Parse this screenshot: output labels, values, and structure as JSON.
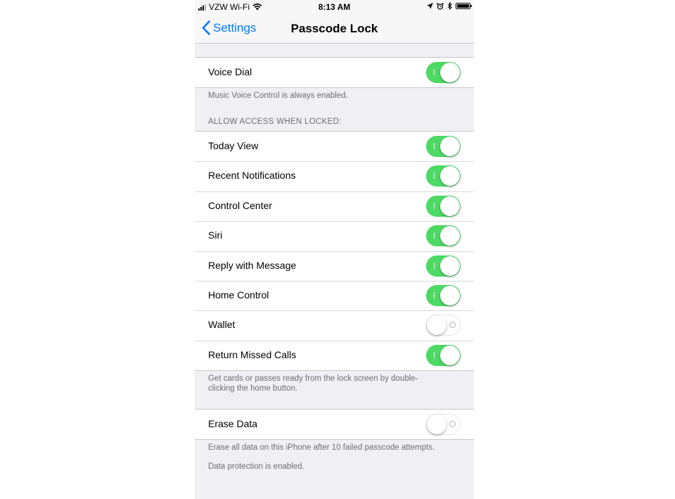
{
  "status_bar": {
    "carrier": "VZW Wi-Fi",
    "time": "8:13 AM"
  },
  "nav": {
    "back_label": "Settings",
    "title": "Passcode Lock"
  },
  "voice_dial": {
    "label": "Voice Dial",
    "on": true,
    "footer": "Music Voice Control is always enabled."
  },
  "locked_access": {
    "header": "ALLOW ACCESS WHEN LOCKED:",
    "items": [
      {
        "label": "Today View",
        "on": true
      },
      {
        "label": "Recent Notifications",
        "on": true
      },
      {
        "label": "Control Center",
        "on": true
      },
      {
        "label": "Siri",
        "on": true
      },
      {
        "label": "Reply with Message",
        "on": true
      },
      {
        "label": "Home Control",
        "on": true
      },
      {
        "label": "Wallet",
        "on": false
      },
      {
        "label": "Return Missed Calls",
        "on": true
      }
    ],
    "footer_line1": "Get cards or passes ready from the lock screen by double-",
    "footer_line2": "clicking the home button."
  },
  "erase_data": {
    "label": "Erase Data",
    "on": false,
    "footer": "Erase all data on this iPhone after 10 failed passcode attempts.",
    "footer2": "Data protection is enabled."
  },
  "colors": {
    "toggle_on": "#4cd964",
    "link_blue": "#007aff",
    "background": "#efeff4"
  }
}
